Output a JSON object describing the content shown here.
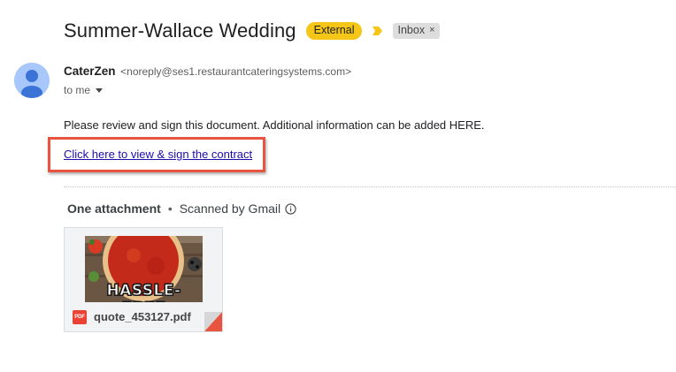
{
  "subject": {
    "title": "Summer-Wallace Wedding",
    "external_label": "External",
    "inbox_label": "Inbox",
    "inbox_remove": "×"
  },
  "sender": {
    "name": "CaterZen",
    "email": "<noreply@ses1.restaurantcateringsystems.com>",
    "recipient": "to me"
  },
  "body": {
    "message": "Please review and sign this document. Additional information can be added HERE.",
    "link_text": "Click here to view & sign the contract"
  },
  "attachments": {
    "count_label": "One attachment",
    "separator": "•",
    "scanned_label": "Scanned by Gmail",
    "items": [
      {
        "thumbnail_text": "HASSLE-FREE",
        "file_badge": "PDF",
        "file_name": "quote_453127.pdf"
      }
    ]
  },
  "colors": {
    "external_chip": "#f5c518",
    "importance_marker": "#f5c518",
    "highlight_box": "#e8543f",
    "link": "#1a0dab",
    "pdf_badge": "#ea4335",
    "avatar": "#a8c7fa"
  },
  "icons": {
    "importance": "importance-marker-icon",
    "avatar": "person-avatar-icon",
    "caret": "chevron-down-icon",
    "info": "info-icon",
    "pdf": "pdf-file-icon"
  }
}
